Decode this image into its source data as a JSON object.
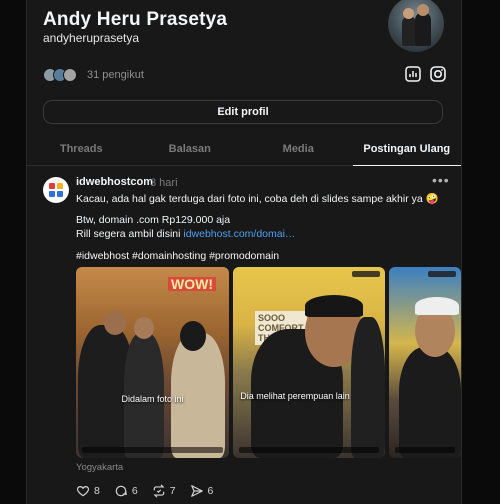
{
  "profile": {
    "name": "Andy Heru Prasetya",
    "handle": "andyheruprasetya",
    "followers": "31 pengikut",
    "edit_label": "Edit profil"
  },
  "tabs": [
    {
      "label": "Threads"
    },
    {
      "label": "Balasan"
    },
    {
      "label": "Media"
    },
    {
      "label": "Postingan Ulang"
    }
  ],
  "post": {
    "user": "idwebhostcom",
    "time": "3 hari",
    "line1": "Kacau, ada hal gak terduga dari foto ini, coba deh di slides sampe akhir ya 🤪",
    "line2": "Btw, domain .com Rp129.000 aja",
    "line3_prefix": "Rill segera ambil disini ",
    "line3_link": "idwebhost.com/domai…",
    "hashtags": "#idwebhost #domainhosting #promodomain",
    "images": [
      {
        "caption": "Didalam foto ini",
        "sign": "WOW!"
      },
      {
        "caption": "Dia melihat perempuan lain",
        "sign": "SOOO COMFORT THIS SER"
      },
      {
        "caption": "",
        "sign": ""
      }
    ],
    "location": "Yogyakarta",
    "likes": "8",
    "comments": "6",
    "reposts": "7",
    "shares": "6"
  },
  "colors": {
    "background": "#0a0a0a",
    "panel": "#181818",
    "link": "#4aa1f0",
    "muted": "#7a7a7a"
  }
}
